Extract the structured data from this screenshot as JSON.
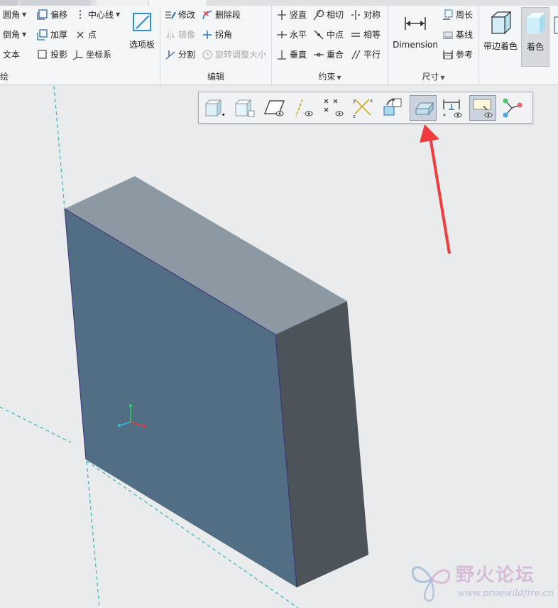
{
  "ribbon": {
    "groups": {
      "sketch": {
        "label": "绘",
        "commands": {
          "fillet": "圆角",
          "offset": "偏移",
          "centerline": "中心线",
          "chamfer": "倒角",
          "thicken": "加厚",
          "point": "点",
          "text": "文本",
          "project": "投影",
          "coord_system": "坐标系",
          "palette": "选项板"
        }
      },
      "edit": {
        "label": "编辑",
        "commands": {
          "modify": "修改",
          "delete_segment": "删除段",
          "mirror": "镜像",
          "corner": "拐角",
          "divide": "分割",
          "rotate_resize": "旋转调整大小"
        }
      },
      "constraints": {
        "label": "约束",
        "commands": {
          "vertical": "竖直",
          "tangent": "相切",
          "symmetric": "对称",
          "horizontal": "水平",
          "midpoint": "中点",
          "equal": "相等",
          "perpendicular": "垂直",
          "coincident": "重合",
          "parallel": "平行"
        }
      },
      "dimension": {
        "label": "尺寸",
        "commands": {
          "dimension": "Dimension",
          "perimeter": "周长",
          "baseline": "基线",
          "reference": "参考"
        }
      },
      "display": {
        "commands": {
          "shading_with_edges": "带边着色",
          "shading": "着色"
        }
      }
    }
  },
  "floating_toolbar": {
    "buttons": [
      {
        "name": "saved-orientations-icon",
        "pressed": false
      },
      {
        "name": "display-style-icon",
        "pressed": false
      },
      {
        "name": "plane-display-icon",
        "pressed": false
      },
      {
        "name": "axis-display-icon",
        "pressed": false
      },
      {
        "name": "point-display-icon",
        "pressed": false
      },
      {
        "name": "csys-display-icon",
        "pressed": false
      },
      {
        "name": "sketch-view-icon",
        "pressed": false
      },
      {
        "name": "shading-toggle-icon",
        "pressed": true
      },
      {
        "name": "dimension-display-icon",
        "pressed": false
      },
      {
        "name": "constraint-display-icon",
        "pressed": true
      },
      {
        "name": "vertex-display-icon",
        "pressed": false
      }
    ]
  },
  "colors": {
    "model_front": "#516e85",
    "model_top": "#8c99a3",
    "model_side": "#4c5459",
    "datum_line": "#36b7b8",
    "arrow": "#f03c3c",
    "viewport_bg": "#e9ebec"
  },
  "watermark": {
    "title": "野火论坛",
    "url": "www.proewildfire.cn"
  }
}
